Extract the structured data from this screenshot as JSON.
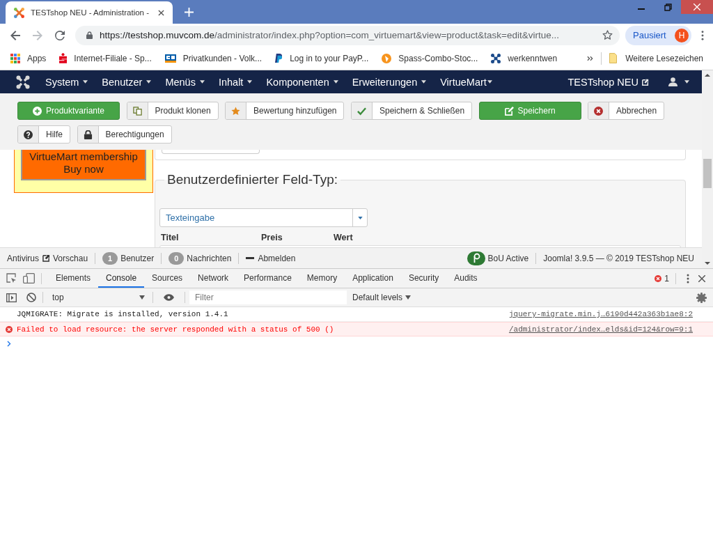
{
  "browser": {
    "tabs": [
      {
        "title": "TESTshop NEU - Administration -",
        "selected": true
      }
    ],
    "back_button": {
      "disabled": false
    },
    "forward_button": {
      "disabled": true
    },
    "address": {
      "host": "https://testshop.muvcom.de",
      "path": "/administrator/index.php?option=com_virtuemart&view=product&task=edit&virtue..."
    },
    "profile": {
      "label": "Pausiert",
      "initial": "H"
    },
    "bookmarks": [
      {
        "title": "Apps"
      },
      {
        "title": "Internet-Filiale - Sp..."
      },
      {
        "title": "Privatkunden - Volk..."
      },
      {
        "title": "Log in to your PayP..."
      },
      {
        "title": "Spass-Combo-Stoc..."
      },
      {
        "title": "werkenntwen"
      }
    ],
    "other_bookmarks": "Weitere Lesezeichen"
  },
  "admin_menu": {
    "items": [
      {
        "label": "System"
      },
      {
        "label": "Benutzer"
      },
      {
        "label": "Menüs"
      },
      {
        "label": "Inhalt"
      },
      {
        "label": "Komponenten"
      },
      {
        "label": "Erweiterungen"
      },
      {
        "label": "VirtueMart"
      }
    ],
    "site_link": "TESTshop NEU"
  },
  "toolbar": {
    "buttons": [
      {
        "label": "Produktvariante",
        "kind": "success"
      },
      {
        "label": "Produkt klonen",
        "kind": "default"
      },
      {
        "label": "Bewertung hinzufügen",
        "kind": "default"
      },
      {
        "label": "Speichern & Schließen",
        "kind": "default"
      },
      {
        "label": "Speichern",
        "kind": "success"
      },
      {
        "label": "Abbrechen",
        "kind": "default"
      },
      {
        "label": "Hilfe",
        "kind": "default"
      },
      {
        "label": "Berechtigungen",
        "kind": "default"
      }
    ]
  },
  "sidebar": {
    "promo": {
      "lines": [
        "VirtueMart membership",
        "Buy now"
      ]
    }
  },
  "form": {
    "fieldset": {
      "legend": "Benutzerdefinierter Feld-Typ:",
      "select": {
        "value": "Texteingabe"
      },
      "columns": [
        "Titel",
        "Preis",
        "Wert"
      ]
    }
  },
  "status_bar": {
    "left": [
      [
        {
          "kind": "text",
          "label": "Antivirus"
        },
        {
          "kind": "external",
          "label": "Vorschau"
        }
      ],
      [
        {
          "kind": "badge",
          "count": "1",
          "label": "Benutzer"
        }
      ],
      [
        {
          "kind": "badge",
          "count": "0",
          "label": "Nachrichten"
        }
      ],
      [
        {
          "kind": "logout",
          "label": "Abmelden"
        }
      ]
    ],
    "right": [
      [
        {
          "kind": "plugin",
          "label": "BoU Active"
        }
      ],
      [
        {
          "kind": "text",
          "label": "Joomla! 3.9.5 — © 2019 TESTshop NEU"
        }
      ]
    ]
  },
  "devtools": {
    "tabs": [
      {
        "label": "Elements",
        "selected": false
      },
      {
        "label": "Console",
        "selected": true
      },
      {
        "label": "Sources",
        "selected": false
      },
      {
        "label": "Network",
        "selected": false
      },
      {
        "label": "Performance",
        "selected": false
      },
      {
        "label": "Memory",
        "selected": false
      },
      {
        "label": "Application",
        "selected": false
      },
      {
        "label": "Security",
        "selected": false
      },
      {
        "label": "Audits",
        "selected": false
      }
    ],
    "error_count": "1",
    "console": {
      "context": "top",
      "filter": {
        "placeholder": "Filter"
      },
      "levels": "Default levels",
      "messages": [
        {
          "kind": "log",
          "text": "JQMIGRATE: Migrate is installed, version 1.4.1",
          "source": "jquery-migrate.min.j…6190d442a363b1ae8:2"
        },
        {
          "kind": "error",
          "text": "Failed to load resource: the server responded with a status of 500 ()",
          "source": "/administrator/index…elds&id=124&row=9:1"
        }
      ]
    }
  }
}
